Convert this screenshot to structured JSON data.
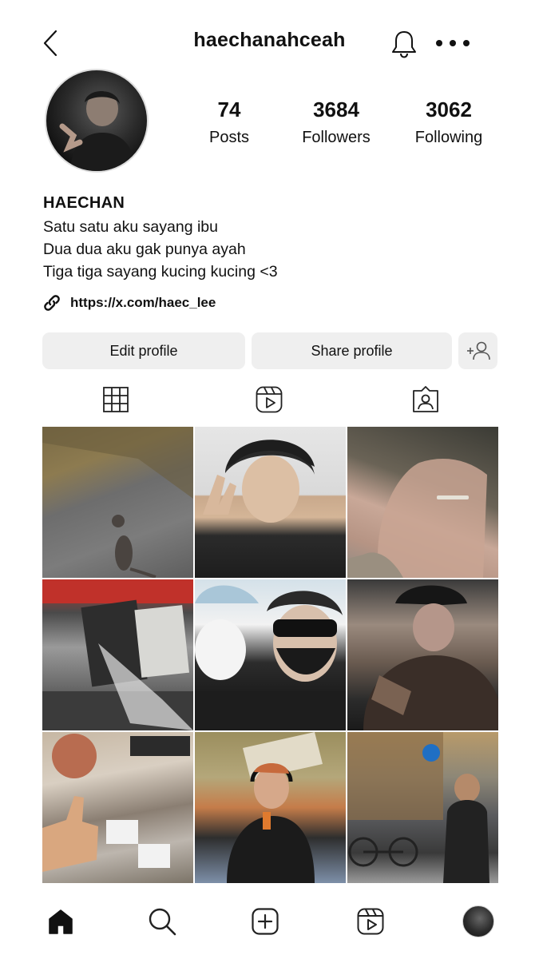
{
  "header": {
    "username": "haechanahceah",
    "icons": {
      "back": "chevron-left-icon",
      "notifications": "bell-icon",
      "more": "more-horizontal-icon"
    }
  },
  "profile": {
    "avatar_icon": "profile-photo",
    "stats": [
      {
        "value": "74",
        "label": "Posts"
      },
      {
        "value": "3684",
        "label": "Followers"
      },
      {
        "value": "3062",
        "label": "Following"
      }
    ],
    "name": "HAECHAN",
    "bio_lines": [
      "Satu satu aku sayang ibu",
      "Dua dua aku gak punya ayah",
      "Tiga tiga sayang kucing kucing <3"
    ],
    "link": "https://x.com/haec_lee"
  },
  "actions": {
    "edit_label": "Edit profile",
    "share_label": "Share profile",
    "add_icon": "add-person-icon"
  },
  "tabs": [
    {
      "id": "grid",
      "icon": "grid-icon"
    },
    {
      "id": "reels",
      "icon": "reels-icon"
    },
    {
      "id": "tagged",
      "icon": "tagged-icon"
    }
  ],
  "posts": [
    {
      "subject": "cat-on-road"
    },
    {
      "subject": "peace-sign-selfie"
    },
    {
      "subject": "ring-hand"
    },
    {
      "subject": "record-store"
    },
    {
      "subject": "masked-selfie"
    },
    {
      "subject": "cap-portrait"
    },
    {
      "subject": "thumbs-up-studio"
    },
    {
      "subject": "headphones-room"
    },
    {
      "subject": "street-bicycles"
    }
  ],
  "bottom_nav": [
    {
      "id": "home",
      "icon": "home-icon",
      "active": true
    },
    {
      "id": "search",
      "icon": "search-icon",
      "active": false
    },
    {
      "id": "create",
      "icon": "plus-square-icon",
      "active": false
    },
    {
      "id": "reels",
      "icon": "reels-icon",
      "active": false
    },
    {
      "id": "profile",
      "icon": "avatar",
      "active": false
    }
  ],
  "colors": {
    "button_bg": "#efefef",
    "text": "#111111",
    "background": "#ffffff"
  }
}
